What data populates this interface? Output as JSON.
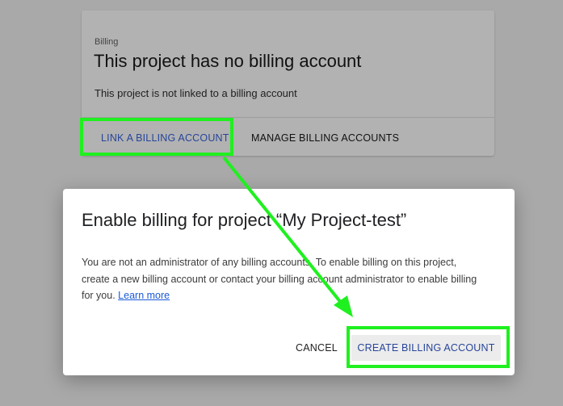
{
  "billing_card": {
    "label": "Billing",
    "title": "This project has no billing account",
    "description": "This project is not linked to a billing account",
    "link_button": "LINK A BILLING ACCOUNT",
    "manage_button": "MANAGE BILLING ACCOUNTS"
  },
  "dialog": {
    "title": "Enable billing for project “My Project-test”",
    "body_text": "You are not an administrator of any billing accounts. To enable billing on this project, create a new billing account or contact your billing account administrator to enable billing for you.",
    "learn_more": "Learn more",
    "cancel_button": "CANCEL",
    "create_button": "CREATE BILLING ACCOUNT"
  },
  "colors": {
    "highlight": "#1ff01f",
    "accent": "#27459a",
    "link": "#1a5ad7",
    "overlay": "#a9a9a9"
  }
}
